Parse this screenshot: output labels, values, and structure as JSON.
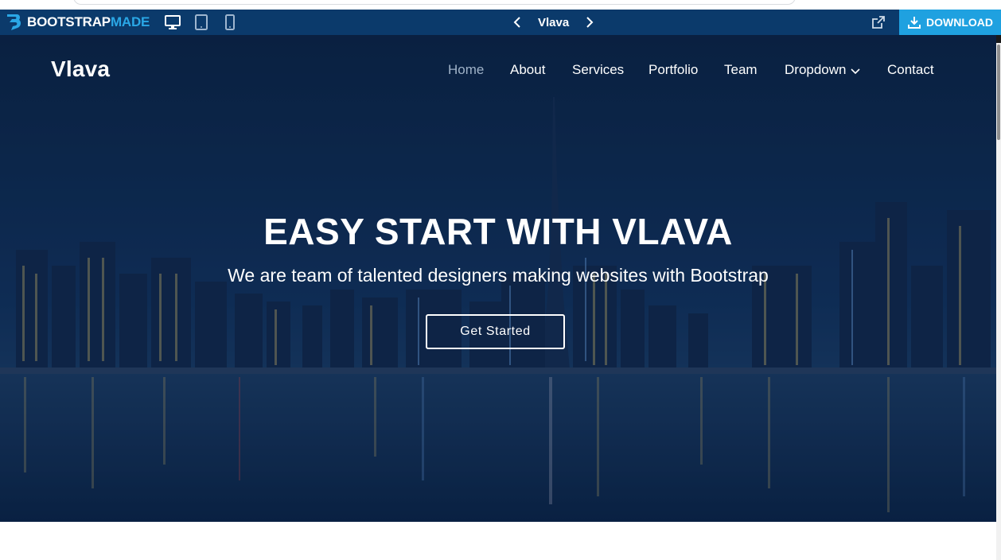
{
  "topbar": {
    "brand_part1": "BOOTSTRAP",
    "brand_part2": "MADE",
    "devices": [
      "desktop-icon",
      "tablet-icon",
      "mobile-icon"
    ],
    "preview_title": "Vlava",
    "download_label": "DOWNLOAD",
    "colors": {
      "bar": "#0b3a6b",
      "download": "#1fa1e0",
      "brand_accent": "#2aa7e6"
    }
  },
  "site": {
    "brand": "Vlava",
    "nav": {
      "home": "Home",
      "about": "About",
      "services": "Services",
      "portfolio": "Portfolio",
      "team": "Team",
      "dropdown": "Dropdown",
      "contact": "Contact"
    },
    "active_nav": "Home"
  },
  "hero": {
    "title": "EASY START WITH VLAVA",
    "subtitle": "We are team of talented designers making websites with Bootstrap",
    "cta": "Get Started"
  }
}
